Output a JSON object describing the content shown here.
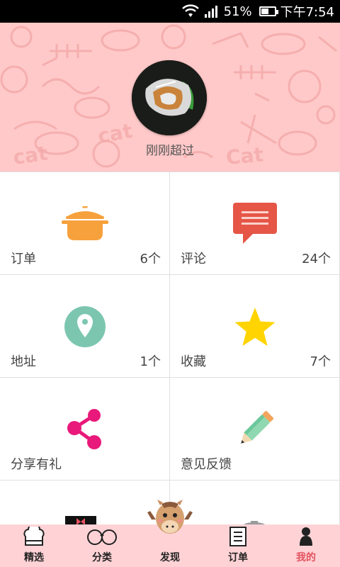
{
  "status_bar": {
    "battery_text": "51%",
    "battery_level": 0.51,
    "time": "下午7:54"
  },
  "profile": {
    "username": "刚刚超过"
  },
  "grid": [
    {
      "label": "订单",
      "count": "6个",
      "icon": "cooking-pot-icon"
    },
    {
      "label": "评论",
      "count": "24个",
      "icon": "comment-bubble-icon"
    },
    {
      "label": "地址",
      "count": "1个",
      "icon": "location-pin-icon"
    },
    {
      "label": "收藏",
      "count": "7个",
      "icon": "star-icon"
    },
    {
      "label": "分享有礼",
      "count": "",
      "icon": "share-icon"
    },
    {
      "label": "意见反馈",
      "count": "",
      "icon": "pencil-icon"
    }
  ],
  "bottom_nav": [
    {
      "label": "精选",
      "icon": "chef-hat-icon",
      "active": false
    },
    {
      "label": "分类",
      "icon": "glasses-icon",
      "active": false
    },
    {
      "label": "发现",
      "icon": "mascot-icon",
      "active": false
    },
    {
      "label": "订单",
      "icon": "order-list-icon",
      "active": false
    },
    {
      "label": "我的",
      "icon": "person-icon",
      "active": true
    }
  ],
  "colors": {
    "header_bg": "#ffc9c9",
    "nav_bg": "#ffd3d6",
    "active": "#e2525f",
    "pot": "#f7a13c",
    "comment": "#e55646",
    "pin": "#7cc6b0",
    "star": "#ffd400",
    "share": "#e8197a"
  }
}
